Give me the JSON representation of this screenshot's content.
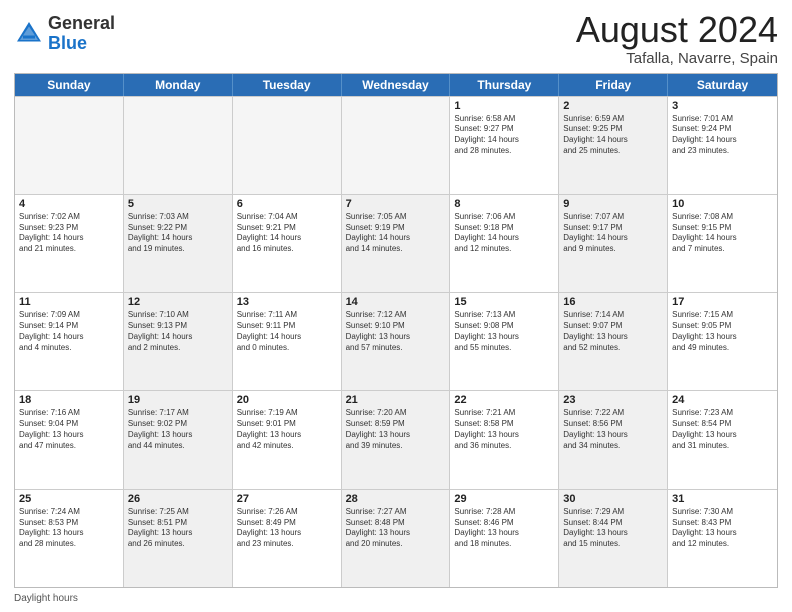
{
  "header": {
    "logo_general": "General",
    "logo_blue": "Blue",
    "month": "August 2024",
    "location": "Tafalla, Navarre, Spain"
  },
  "weekdays": [
    "Sunday",
    "Monday",
    "Tuesday",
    "Wednesday",
    "Thursday",
    "Friday",
    "Saturday"
  ],
  "footer": "Daylight hours",
  "rows": [
    [
      {
        "day": "",
        "info": "",
        "empty": true
      },
      {
        "day": "",
        "info": "",
        "empty": true
      },
      {
        "day": "",
        "info": "",
        "empty": true
      },
      {
        "day": "",
        "info": "",
        "empty": true
      },
      {
        "day": "1",
        "info": "Sunrise: 6:58 AM\nSunset: 9:27 PM\nDaylight: 14 hours\nand 28 minutes.",
        "empty": false,
        "shaded": false
      },
      {
        "day": "2",
        "info": "Sunrise: 6:59 AM\nSunset: 9:25 PM\nDaylight: 14 hours\nand 25 minutes.",
        "empty": false,
        "shaded": true
      },
      {
        "day": "3",
        "info": "Sunrise: 7:01 AM\nSunset: 9:24 PM\nDaylight: 14 hours\nand 23 minutes.",
        "empty": false,
        "shaded": false
      }
    ],
    [
      {
        "day": "4",
        "info": "Sunrise: 7:02 AM\nSunset: 9:23 PM\nDaylight: 14 hours\nand 21 minutes.",
        "empty": false,
        "shaded": false
      },
      {
        "day": "5",
        "info": "Sunrise: 7:03 AM\nSunset: 9:22 PM\nDaylight: 14 hours\nand 19 minutes.",
        "empty": false,
        "shaded": true
      },
      {
        "day": "6",
        "info": "Sunrise: 7:04 AM\nSunset: 9:21 PM\nDaylight: 14 hours\nand 16 minutes.",
        "empty": false,
        "shaded": false
      },
      {
        "day": "7",
        "info": "Sunrise: 7:05 AM\nSunset: 9:19 PM\nDaylight: 14 hours\nand 14 minutes.",
        "empty": false,
        "shaded": true
      },
      {
        "day": "8",
        "info": "Sunrise: 7:06 AM\nSunset: 9:18 PM\nDaylight: 14 hours\nand 12 minutes.",
        "empty": false,
        "shaded": false
      },
      {
        "day": "9",
        "info": "Sunrise: 7:07 AM\nSunset: 9:17 PM\nDaylight: 14 hours\nand 9 minutes.",
        "empty": false,
        "shaded": true
      },
      {
        "day": "10",
        "info": "Sunrise: 7:08 AM\nSunset: 9:15 PM\nDaylight: 14 hours\nand 7 minutes.",
        "empty": false,
        "shaded": false
      }
    ],
    [
      {
        "day": "11",
        "info": "Sunrise: 7:09 AM\nSunset: 9:14 PM\nDaylight: 14 hours\nand 4 minutes.",
        "empty": false,
        "shaded": false
      },
      {
        "day": "12",
        "info": "Sunrise: 7:10 AM\nSunset: 9:13 PM\nDaylight: 14 hours\nand 2 minutes.",
        "empty": false,
        "shaded": true
      },
      {
        "day": "13",
        "info": "Sunrise: 7:11 AM\nSunset: 9:11 PM\nDaylight: 14 hours\nand 0 minutes.",
        "empty": false,
        "shaded": false
      },
      {
        "day": "14",
        "info": "Sunrise: 7:12 AM\nSunset: 9:10 PM\nDaylight: 13 hours\nand 57 minutes.",
        "empty": false,
        "shaded": true
      },
      {
        "day": "15",
        "info": "Sunrise: 7:13 AM\nSunset: 9:08 PM\nDaylight: 13 hours\nand 55 minutes.",
        "empty": false,
        "shaded": false
      },
      {
        "day": "16",
        "info": "Sunrise: 7:14 AM\nSunset: 9:07 PM\nDaylight: 13 hours\nand 52 minutes.",
        "empty": false,
        "shaded": true
      },
      {
        "day": "17",
        "info": "Sunrise: 7:15 AM\nSunset: 9:05 PM\nDaylight: 13 hours\nand 49 minutes.",
        "empty": false,
        "shaded": false
      }
    ],
    [
      {
        "day": "18",
        "info": "Sunrise: 7:16 AM\nSunset: 9:04 PM\nDaylight: 13 hours\nand 47 minutes.",
        "empty": false,
        "shaded": false
      },
      {
        "day": "19",
        "info": "Sunrise: 7:17 AM\nSunset: 9:02 PM\nDaylight: 13 hours\nand 44 minutes.",
        "empty": false,
        "shaded": true
      },
      {
        "day": "20",
        "info": "Sunrise: 7:19 AM\nSunset: 9:01 PM\nDaylight: 13 hours\nand 42 minutes.",
        "empty": false,
        "shaded": false
      },
      {
        "day": "21",
        "info": "Sunrise: 7:20 AM\nSunset: 8:59 PM\nDaylight: 13 hours\nand 39 minutes.",
        "empty": false,
        "shaded": true
      },
      {
        "day": "22",
        "info": "Sunrise: 7:21 AM\nSunset: 8:58 PM\nDaylight: 13 hours\nand 36 minutes.",
        "empty": false,
        "shaded": false
      },
      {
        "day": "23",
        "info": "Sunrise: 7:22 AM\nSunset: 8:56 PM\nDaylight: 13 hours\nand 34 minutes.",
        "empty": false,
        "shaded": true
      },
      {
        "day": "24",
        "info": "Sunrise: 7:23 AM\nSunset: 8:54 PM\nDaylight: 13 hours\nand 31 minutes.",
        "empty": false,
        "shaded": false
      }
    ],
    [
      {
        "day": "25",
        "info": "Sunrise: 7:24 AM\nSunset: 8:53 PM\nDaylight: 13 hours\nand 28 minutes.",
        "empty": false,
        "shaded": false
      },
      {
        "day": "26",
        "info": "Sunrise: 7:25 AM\nSunset: 8:51 PM\nDaylight: 13 hours\nand 26 minutes.",
        "empty": false,
        "shaded": true
      },
      {
        "day": "27",
        "info": "Sunrise: 7:26 AM\nSunset: 8:49 PM\nDaylight: 13 hours\nand 23 minutes.",
        "empty": false,
        "shaded": false
      },
      {
        "day": "28",
        "info": "Sunrise: 7:27 AM\nSunset: 8:48 PM\nDaylight: 13 hours\nand 20 minutes.",
        "empty": false,
        "shaded": true
      },
      {
        "day": "29",
        "info": "Sunrise: 7:28 AM\nSunset: 8:46 PM\nDaylight: 13 hours\nand 18 minutes.",
        "empty": false,
        "shaded": false
      },
      {
        "day": "30",
        "info": "Sunrise: 7:29 AM\nSunset: 8:44 PM\nDaylight: 13 hours\nand 15 minutes.",
        "empty": false,
        "shaded": true
      },
      {
        "day": "31",
        "info": "Sunrise: 7:30 AM\nSunset: 8:43 PM\nDaylight: 13 hours\nand 12 minutes.",
        "empty": false,
        "shaded": false
      }
    ]
  ]
}
